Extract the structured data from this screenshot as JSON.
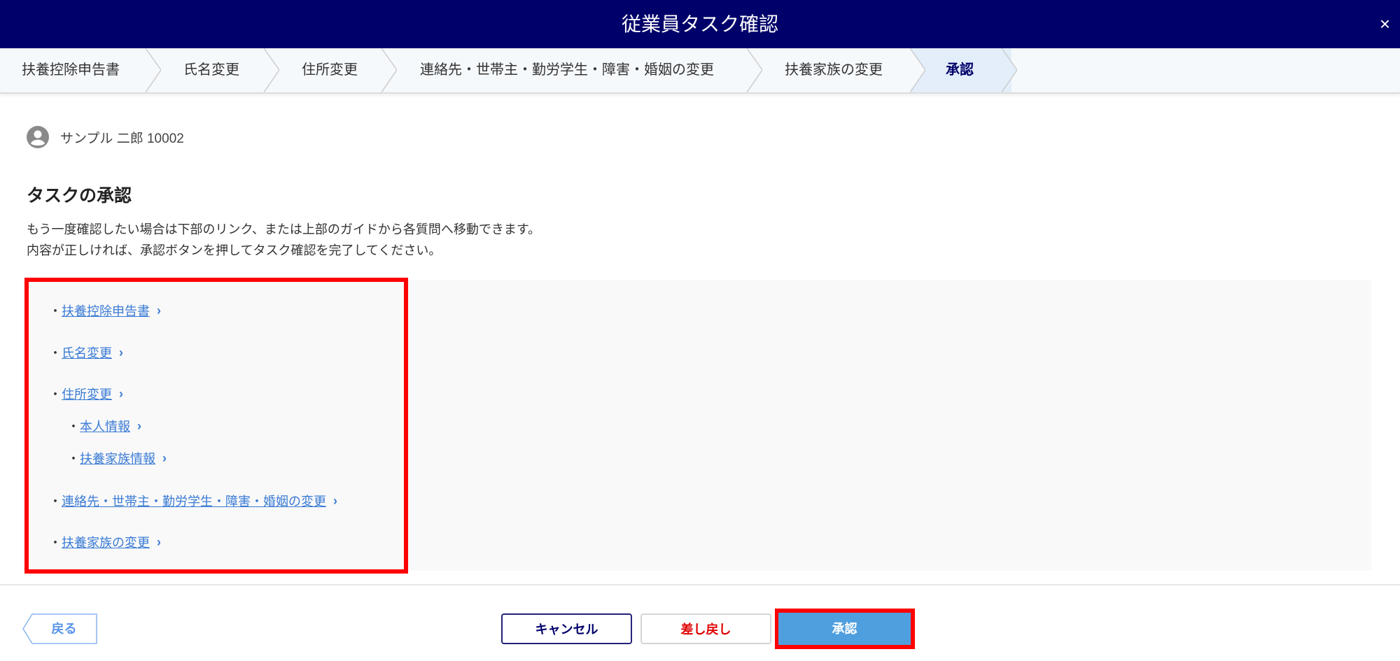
{
  "header": {
    "title": "従業員タスク確認",
    "close_label": "×"
  },
  "steps": [
    {
      "label": "扶養控除申告書"
    },
    {
      "label": "氏名変更"
    },
    {
      "label": "住所変更"
    },
    {
      "label": "連絡先・世帯主・勤労学生・障害・婚姻の変更"
    },
    {
      "label": "扶養家族の変更"
    },
    {
      "label": "承認"
    }
  ],
  "user": {
    "name": "サンプル 二郎 10002"
  },
  "main": {
    "heading": "タスクの承認",
    "desc1": "もう一度確認したい場合は下部のリンク、または上部のガイドから各質問へ移動できます。",
    "desc2": "内容が正しければ、承認ボタンを押してタスク確認を完了してください。"
  },
  "links": [
    {
      "label": "扶養控除申告書"
    },
    {
      "label": "氏名変更"
    },
    {
      "label": "住所変更"
    },
    {
      "label": "本人情報"
    },
    {
      "label": "扶養家族情報"
    },
    {
      "label": "連絡先・世帯主・勤労学生・障害・婚姻の変更"
    },
    {
      "label": "扶養家族の変更"
    }
  ],
  "bullet": "・",
  "chevron": "›",
  "footer": {
    "back": "戻る",
    "cancel": "キャンセル",
    "remand": "差し戻し",
    "approve": "承認"
  },
  "colors": {
    "header": "#00006a",
    "link": "#3a7bd5",
    "approve": "#4f9fdf",
    "highlight": "#ff0000"
  }
}
